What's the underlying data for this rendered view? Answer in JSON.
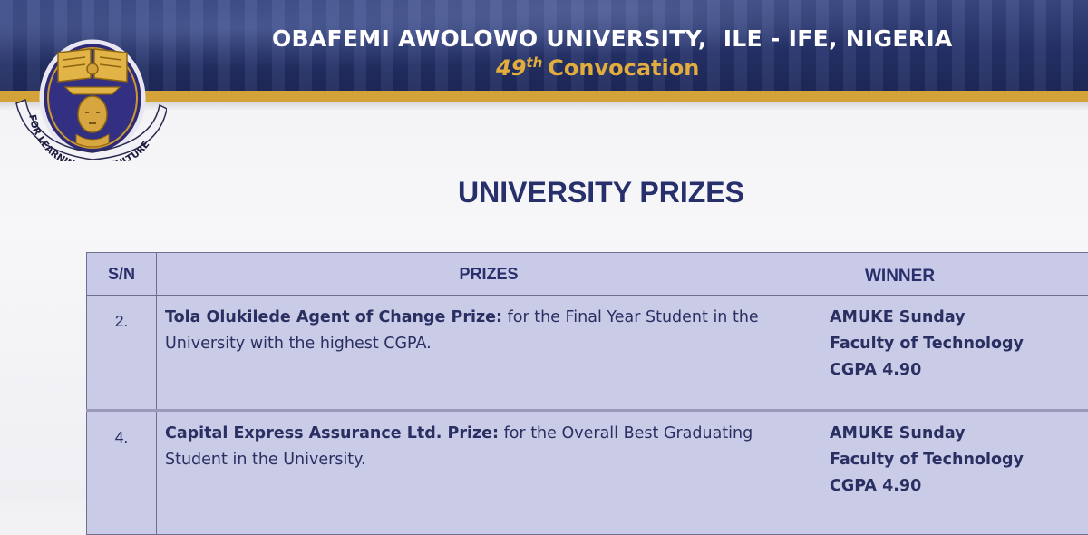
{
  "header": {
    "university_name": "OBAFEMI AWOLOWO UNIVERSITY,  ILE - IFE, NIGERIA",
    "convocation_number": "49",
    "convocation_suffix": "th",
    "convocation_label": "Convocation",
    "logo_motto": "FOR LEARNING AND CULTURE"
  },
  "page_title": "UNIVERSITY PRIZES",
  "table": {
    "headers": {
      "sn": "S/N",
      "prizes": "PRIZES",
      "winner": "WINNER"
    },
    "rows": [
      {
        "sn": "2.",
        "prize_name": "Tola Olukilede Agent of Change Prize:",
        "prize_desc": " for the Final Year Student in the University with the highest CGPA.",
        "winner_name": "AMUKE Sunday",
        "winner_faculty": "Faculty of Technology",
        "winner_cgpa": "CGPA 4.90"
      },
      {
        "sn": "4.",
        "prize_name": "Capital Express Assurance Ltd. Prize:",
        "prize_desc": " for the Overall Best Graduating Student in the University.",
        "winner_name": "AMUKE Sunday",
        "winner_faculty": "Faculty of Technology",
        "winner_cgpa": "CGPA 4.90"
      }
    ]
  },
  "colors": {
    "banner_navy": "#26336b",
    "banner_gold": "#d3a33a",
    "title_navy": "#27306b",
    "table_fill": "#cacbe6",
    "convocation_gold": "#e3ad3d"
  }
}
